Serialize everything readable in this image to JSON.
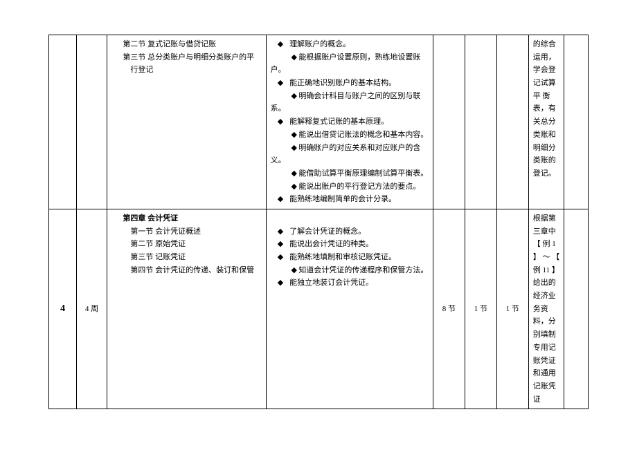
{
  "rows": [
    {
      "num": "",
      "week": "",
      "content_lines": [
        {
          "text": "第二节  复式记账与借贷记账",
          "cls": "indent1"
        },
        {
          "text": "第三节  总分类账户与明细分类账户的平",
          "cls": "indent1"
        },
        {
          "text": "行登记",
          "cls": "indent2"
        }
      ],
      "objectives": [
        {
          "bullet": true,
          "text": "理解账户的概念。"
        },
        {
          "bullet": true,
          "text": "能根据账户设置原则，熟练地设置账户。",
          "wrap": true
        },
        {
          "bullet": true,
          "text": "能正确地识别账户的基本结构。"
        },
        {
          "bullet": true,
          "text": "明确会计科目与账户之间的区别与联系。",
          "wrap": true
        },
        {
          "bullet": true,
          "text": "能解释复式记账的基本原理。"
        },
        {
          "bullet": true,
          "text": "能说出借贷记账法的概念和基本内容。",
          "wrap": true
        },
        {
          "bullet": true,
          "text": "明确账户的对应关系和对应账户的含义。",
          "wrap": true
        },
        {
          "bullet": true,
          "text": "能借助试算平衡原理编制试算平衡表。",
          "wrap": true
        },
        {
          "bullet": true,
          "text": "能说出账户的平行登记方法的要点。",
          "wrap": true
        },
        {
          "bullet": true,
          "text": "能熟练地编制简单的会计分录。"
        }
      ],
      "h1": "",
      "h2": "",
      "h3": "",
      "note": "的综合运用，学会登记试算 平 衡表，有关总分类账和明细分类账的登记。"
    },
    {
      "num": "4",
      "week": "4 周",
      "content_lines": [
        {
          "text": "第四章  会计凭证",
          "cls": "bold indent1"
        },
        {
          "text": "第一节  会计凭证概述",
          "cls": "indent2"
        },
        {
          "text": "第二节  原始凭证",
          "cls": "indent2"
        },
        {
          "text": "第三节  记账凭证",
          "cls": "indent2"
        },
        {
          "text": "第四节  会计凭证的传递、装订和保管",
          "cls": "indent2"
        }
      ],
      "objectives_leading_blank": true,
      "objectives": [
        {
          "bullet": true,
          "text": "了解会计凭证的概念。"
        },
        {
          "bullet": true,
          "text": "能说出会计凭证的种类。"
        },
        {
          "bullet": true,
          "text": "能熟练地填制和审核记账凭证。"
        },
        {
          "bullet": true,
          "text": "知道会计凭证的传递程序和保管方法。",
          "wrap": true
        },
        {
          "bullet": true,
          "text": "能独立地装订会计凭证。"
        }
      ],
      "h1": "8 节",
      "h2": "1 节",
      "h3": "1 节",
      "note": "根据第三章中 【 例 1 】 ～ 【 例 11 】 给出的经济业务资料，分别填制专用记账凭证和通用记账凭证"
    }
  ]
}
